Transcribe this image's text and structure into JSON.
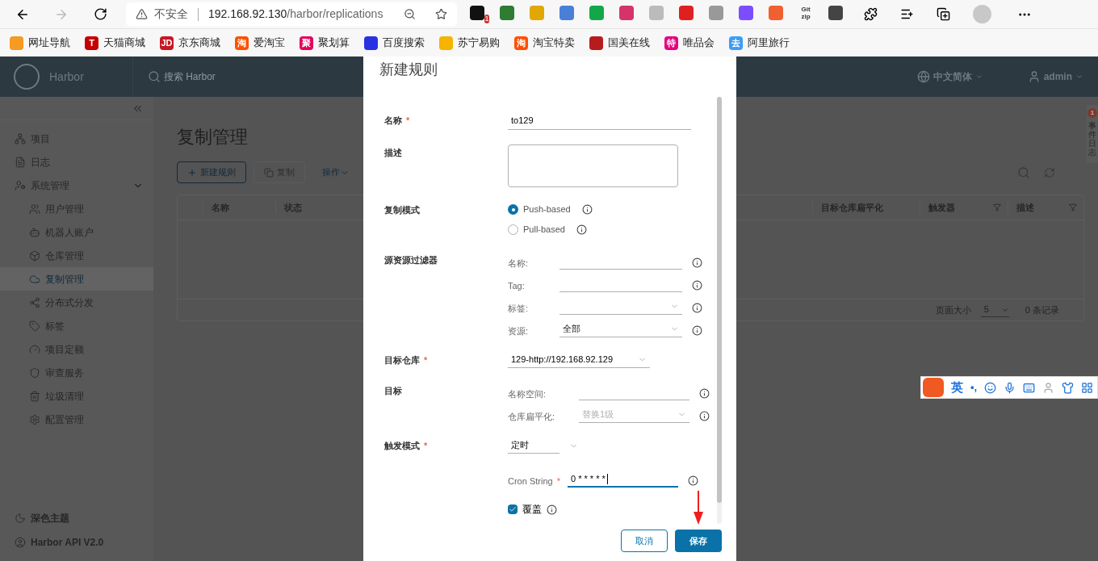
{
  "browser": {
    "security": "不安全",
    "url_host": "192.168.92.130",
    "url_path": "/harbor/replications",
    "extensions": [
      {
        "color": "#111111",
        "badge": "1"
      },
      {
        "color": "#2e7d32"
      },
      {
        "color": "#e0a800"
      },
      {
        "color": "#4a7fd8"
      },
      {
        "color": "#12a84a"
      },
      {
        "color": "#d6336c"
      },
      {
        "color": "#bbbbbb"
      },
      {
        "color": "#e02020"
      },
      {
        "color": "#999999"
      },
      {
        "color": "#7c4dff"
      },
      {
        "color": "#f06030"
      },
      {
        "color": "#333333",
        "lines": [
          "Git",
          "zip"
        ]
      },
      {
        "color": "#444444"
      }
    ],
    "bookmarks": [
      {
        "label": "网址导航",
        "color": "#f59a23"
      },
      {
        "label": "天猫商城",
        "color": "#c40000",
        "glyph": "T"
      },
      {
        "label": "京东商城",
        "color": "#c81623",
        "glyph": "JD"
      },
      {
        "label": "爱淘宝",
        "color": "#ff5000",
        "glyph": "淘"
      },
      {
        "label": "聚划算",
        "color": "#e6005c",
        "glyph": "聚"
      },
      {
        "label": "百度搜索",
        "color": "#2932e1"
      },
      {
        "label": "苏宁易购",
        "color": "#f4b400"
      },
      {
        "label": "淘宝特卖",
        "color": "#ff5000",
        "glyph": "淘"
      },
      {
        "label": "国美在线",
        "color": "#b71c1c"
      },
      {
        "label": "唯品会",
        "color": "#e4007f",
        "glyph": "特"
      },
      {
        "label": "阿里旅行",
        "color": "#3d9df5",
        "glyph": "去"
      }
    ]
  },
  "header": {
    "brand": "Harbor",
    "search_placeholder": "搜索 Harbor",
    "language": "中文简体",
    "user": "admin"
  },
  "sidebar": {
    "items": [
      {
        "label": "项目",
        "selected": false
      },
      {
        "label": "日志",
        "selected": false
      },
      {
        "label": "系统管理",
        "selected": false,
        "expanded": true,
        "children": [
          {
            "label": "用户管理",
            "selected": false
          },
          {
            "label": "机器人账户",
            "selected": false
          },
          {
            "label": "仓库管理",
            "selected": false
          },
          {
            "label": "复制管理",
            "selected": true
          },
          {
            "label": "分布式分发",
            "selected": false
          },
          {
            "label": "标签",
            "selected": false
          },
          {
            "label": "项目定额",
            "selected": false
          },
          {
            "label": "审查服务",
            "selected": false
          },
          {
            "label": "垃圾清理",
            "selected": false
          },
          {
            "label": "配置管理",
            "selected": false
          }
        ]
      }
    ],
    "footer": [
      "深色主题",
      "Harbor API V2.0"
    ]
  },
  "page": {
    "title": "复制管理",
    "actions": [
      {
        "label": "新建规则",
        "kind": "primary"
      },
      {
        "label": "复制",
        "kind": "copy",
        "disabled": true
      },
      {
        "label": "操作",
        "kind": "menu"
      }
    ],
    "table": {
      "columns_left": [
        "名称",
        "状态"
      ],
      "columns_right": [
        {
          "label": "目标仓库扁平化",
          "filter": false
        },
        {
          "label": "触发器",
          "filter": true
        },
        {
          "label": "描述",
          "filter": true
        }
      ],
      "page_size_label": "页面大小",
      "page_size": "5",
      "count": "0 条记录"
    }
  },
  "event_tab": {
    "badge": "1",
    "label": "事件日志"
  },
  "modal": {
    "title": "新建规则",
    "required_mark": "*",
    "sections": [
      {
        "label": "名称",
        "required": true,
        "controls": [
          {
            "kind": "input",
            "value": "to129"
          }
        ]
      },
      {
        "label": "描述",
        "required": false,
        "controls": [
          {
            "kind": "textarea"
          }
        ]
      },
      {
        "label": "复制模式",
        "required": false,
        "controls": [
          {
            "kind": "radio",
            "label": "Push-based",
            "selected": true
          },
          {
            "kind": "radio",
            "label": "Pull-based",
            "selected": false
          }
        ]
      },
      {
        "label": "源资源过滤器",
        "required": false,
        "controls": [
          {
            "kind": "sub-input",
            "label": "名称:"
          },
          {
            "kind": "sub-input",
            "label": "Tag:"
          },
          {
            "kind": "sub-select",
            "label": "标签:"
          },
          {
            "kind": "sub-select",
            "label": "资源:",
            "value": "全部"
          }
        ]
      },
      {
        "label": "目标仓库",
        "required": true,
        "controls": [
          {
            "kind": "select",
            "value": "129-http://192.168.92.129"
          }
        ]
      },
      {
        "label": "目标",
        "required": false,
        "controls": [
          {
            "kind": "sub-input",
            "label": "名称空间:",
            "wide": true
          },
          {
            "kind": "sub-select",
            "label": "仓库扁平化:",
            "value": "替换1级",
            "disabled": true,
            "wide": true
          }
        ]
      },
      {
        "label": "触发模式",
        "required": true,
        "controls": [
          {
            "kind": "short-select",
            "value": "定时"
          },
          {
            "kind": "cron",
            "label": "Cron String",
            "required": true,
            "value": "0 * * * * *"
          },
          {
            "kind": "checkbox",
            "label": "覆盖",
            "checked": true
          }
        ]
      }
    ],
    "buttons": [
      {
        "label": "取消",
        "kind": "outline"
      },
      {
        "label": "保存",
        "kind": "solid"
      }
    ]
  },
  "ime": {
    "mode": "英",
    "punct": "•,"
  }
}
